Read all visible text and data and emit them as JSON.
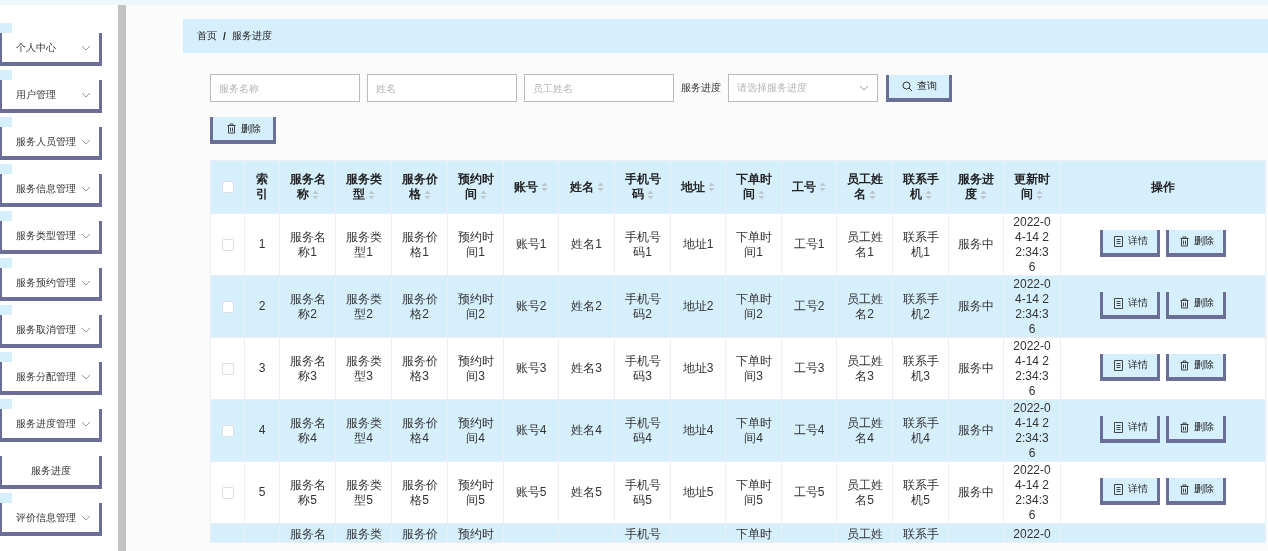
{
  "sidebar": {
    "items": [
      {
        "label": "个人中心",
        "kind": "group"
      },
      {
        "label": "用户管理",
        "kind": "group"
      },
      {
        "label": "服务人员管理",
        "kind": "group"
      },
      {
        "label": "服务信息管理",
        "kind": "group"
      },
      {
        "label": "服务类型管理",
        "kind": "group"
      },
      {
        "label": "服务预约管理",
        "kind": "group"
      },
      {
        "label": "服务取消管理",
        "kind": "group"
      },
      {
        "label": "服务分配管理",
        "kind": "group"
      },
      {
        "label": "服务进度管理",
        "kind": "group"
      },
      {
        "label": "服务进度",
        "kind": "link"
      },
      {
        "label": "评价信息管理",
        "kind": "group"
      }
    ]
  },
  "breadcrumb": [
    "首页",
    "/",
    "服务进度"
  ],
  "search": {
    "fields": [
      {
        "placeholder": "服务名称",
        "kind": "input"
      },
      {
        "placeholder": "姓名",
        "kind": "input"
      },
      {
        "placeholder": "员工姓名",
        "kind": "input"
      },
      {
        "label": "服务进度",
        "placeholder": "请选择服务进度",
        "kind": "select"
      }
    ],
    "button": "查询"
  },
  "bulk_delete": "删除",
  "table": {
    "all_selected": false,
    "columns": [
      {
        "label": "索引",
        "sortable": false
      },
      {
        "label": "服务名称",
        "sortable": true
      },
      {
        "label": "服务类型",
        "sortable": true
      },
      {
        "label": "服务价格",
        "sortable": true
      },
      {
        "label": "预约时间",
        "sortable": true
      },
      {
        "label": "账号",
        "sortable": true
      },
      {
        "label": "姓名",
        "sortable": true
      },
      {
        "label": "手机号码",
        "sortable": true
      },
      {
        "label": "地址",
        "sortable": true
      },
      {
        "label": "下单时间",
        "sortable": true
      },
      {
        "label": "工号",
        "sortable": true
      },
      {
        "label": "员工姓名",
        "sortable": true
      },
      {
        "label": "联系手机",
        "sortable": true
      },
      {
        "label": "服务进度",
        "sortable": true
      },
      {
        "label": "更新时间",
        "sortable": true
      },
      {
        "label": "操作",
        "sortable": false
      }
    ],
    "rows": [
      {
        "selected": false,
        "cells": [
          "1",
          "服务名称1",
          "服务类型1",
          "服务价格1",
          "预约时间1",
          "账号1",
          "姓名1",
          "手机号码1",
          "地址1",
          "下单时间1",
          "工号1",
          "员工姓名1",
          "联系手机1",
          "服务中",
          "2022-04-14 22:34:36"
        ],
        "actions": [
          "详情",
          "删除"
        ]
      },
      {
        "selected": false,
        "cells": [
          "2",
          "服务名称2",
          "服务类型2",
          "服务价格2",
          "预约时间2",
          "账号2",
          "姓名2",
          "手机号码2",
          "地址2",
          "下单时间2",
          "工号2",
          "员工姓名2",
          "联系手机2",
          "服务中",
          "2022-04-14 22:34:36"
        ],
        "actions": [
          "详情",
          "删除"
        ]
      },
      {
        "selected": false,
        "cells": [
          "3",
          "服务名称3",
          "服务类型3",
          "服务价格3",
          "预约时间3",
          "账号3",
          "姓名3",
          "手机号码3",
          "地址3",
          "下单时间3",
          "工号3",
          "员工姓名3",
          "联系手机3",
          "服务中",
          "2022-04-14 22:34:36"
        ],
        "actions": [
          "详情",
          "删除"
        ]
      },
      {
        "selected": false,
        "cells": [
          "4",
          "服务名称4",
          "服务类型4",
          "服务价格4",
          "预约时间4",
          "账号4",
          "姓名4",
          "手机号码4",
          "地址4",
          "下单时间4",
          "工号4",
          "员工姓名4",
          "联系手机4",
          "服务中",
          "2022-04-14 22:34:36"
        ],
        "actions": [
          "详情",
          "删除"
        ]
      },
      {
        "selected": false,
        "cells": [
          "5",
          "服务名称5",
          "服务类型5",
          "服务价格5",
          "预约时间5",
          "账号5",
          "姓名5",
          "手机号码5",
          "地址5",
          "下单时间5",
          "工号5",
          "员工姓名5",
          "联系手机5",
          "服务中",
          "2022-04-14 22:34:36"
        ],
        "actions": [
          "详情",
          "删除"
        ]
      }
    ],
    "cut_row": {
      "cells": [
        {
          "kind": "empty"
        },
        {
          "kind": "text",
          "text": "服务名"
        },
        {
          "kind": "text",
          "text": "服务类"
        },
        {
          "kind": "text",
          "text": "服务价"
        },
        {
          "kind": "text",
          "text": "预约时"
        },
        {
          "kind": "empty"
        },
        {
          "kind": "empty"
        },
        {
          "kind": "text",
          "text": "手机号"
        },
        {
          "kind": "empty"
        },
        {
          "kind": "text",
          "text": "下单时"
        },
        {
          "kind": "empty"
        },
        {
          "kind": "text",
          "text": "员工姓"
        },
        {
          "kind": "text",
          "text": "联系手"
        },
        {
          "kind": "empty"
        },
        {
          "kind": "text",
          "text": "2022-0"
        }
      ]
    }
  }
}
